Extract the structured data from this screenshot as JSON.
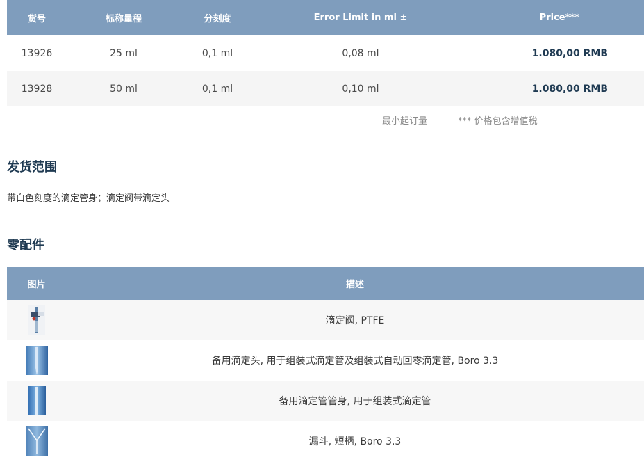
{
  "price_table": {
    "headers": {
      "article_no": "货号",
      "capacity": "标称量程",
      "graduation": "分刻度",
      "error_limit": "Error Limit in ml ±",
      "price": "Price***"
    },
    "rows": [
      {
        "article_no": "13926",
        "capacity": "25 ml",
        "graduation": "0,1 ml",
        "error_limit": "0,08 ml",
        "price": "1.080,00 RMB"
      },
      {
        "article_no": "13928",
        "capacity": "50 ml",
        "graduation": "0,1 ml",
        "error_limit": "0,10 ml",
        "price": "1.080,00 RMB"
      }
    ]
  },
  "notes": {
    "min_order": "最小起订量",
    "tax": "*** 价格包含增值税"
  },
  "scope": {
    "title": "发货范围",
    "text": "带白色刻度的滴定管身；滴定阀带滴定头"
  },
  "parts": {
    "title": "零配件",
    "headers": {
      "image": "图片",
      "description": "描述"
    },
    "rows": [
      {
        "image_icon": "stopcock-valve-thumbnail",
        "description": "滴定阀, PTFE"
      },
      {
        "image_icon": "burette-tip-thumbnail",
        "description": "备用滴定头, 用于组装式滴定管及组装式自动回零滴定管, Boro 3.3"
      },
      {
        "image_icon": "burette-tube-thumbnail",
        "description": "备用滴定管管身, 用于组装式滴定管"
      },
      {
        "image_icon": "funnel-thumbnail",
        "description": "漏斗, 短柄, Boro 3.3"
      }
    ]
  }
}
